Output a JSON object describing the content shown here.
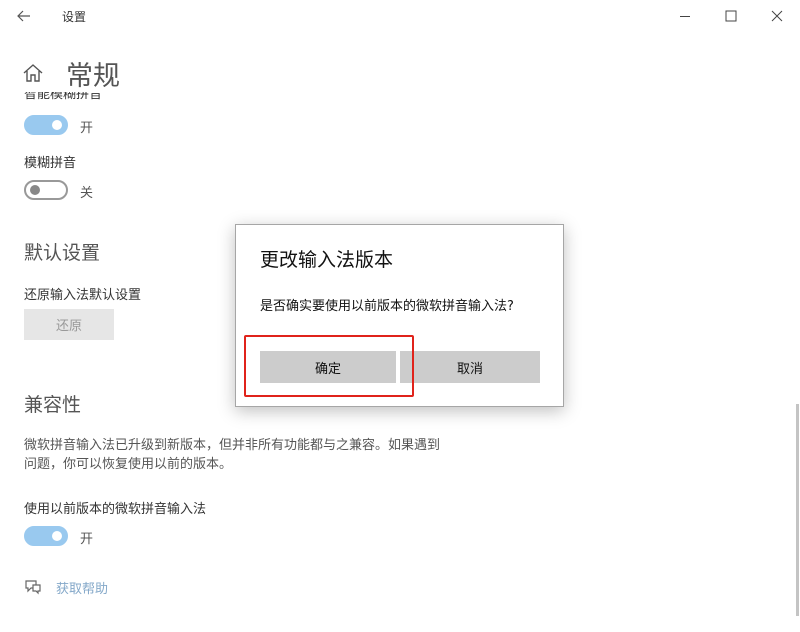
{
  "window": {
    "title": "设置",
    "minimize_glyph": "—",
    "maximize_glyph": "☐",
    "close_glyph": "✕"
  },
  "header": {
    "title": "常规"
  },
  "fuzzy_smart": {
    "label_partial": "智能模糊拼音",
    "state": "开",
    "on": true
  },
  "fuzzy": {
    "label": "模糊拼音",
    "state": "关",
    "on": false
  },
  "defaults": {
    "heading": "默认设置",
    "label": "还原输入法默认设置",
    "button": "还原"
  },
  "compat": {
    "heading": "兼容性",
    "desc_line1": "微软拼音输入法已升级到新版本，但并非所有功能都与之兼容。如果遇到",
    "desc_line2": "问题，你可以恢复使用以前的版本。",
    "toggle_label": "使用以前版本的微软拼音输入法",
    "state": "开",
    "on": true
  },
  "help": {
    "link": "获取帮助"
  },
  "dialog": {
    "title": "更改输入法版本",
    "message": "是否确实要使用以前版本的微软拼音输入法?",
    "confirm": "确定",
    "cancel": "取消"
  },
  "colors": {
    "accent_toggle": "#99c9ef",
    "highlight": "#e0231b",
    "link": "#84a8c9"
  }
}
